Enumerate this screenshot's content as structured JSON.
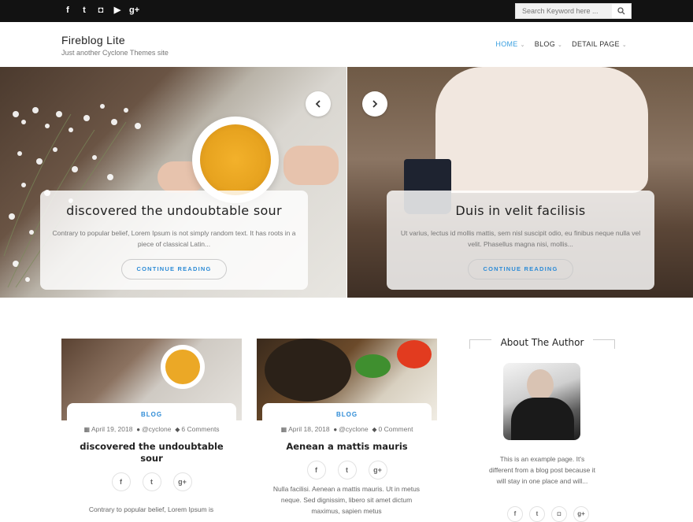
{
  "topbar": {
    "social": [
      {
        "icon": "facebook-icon",
        "glyph": "f"
      },
      {
        "icon": "twitter-icon",
        "glyph": "t"
      },
      {
        "icon": "instagram-icon",
        "glyph": "◘"
      },
      {
        "icon": "youtube-icon",
        "glyph": "▶"
      },
      {
        "icon": "googleplus-icon",
        "glyph": "g+"
      }
    ],
    "search_placeholder": "Search Keyword here ..."
  },
  "header": {
    "site_title": "Fireblog Lite",
    "tagline": "Just another Cyclone Themes site",
    "nav": [
      {
        "label": "HOME"
      },
      {
        "label": "BLOG"
      },
      {
        "label": "DETAIL PAGE"
      }
    ]
  },
  "slider": {
    "slides": [
      {
        "title": "discovered the undoubtable sour",
        "excerpt": "Contrary to popular belief, Lorem Ipsum is not simply random text. It has roots in a piece of classical Latin...",
        "button": "CONTINUE READING"
      },
      {
        "title": "Duis in velit facilisis",
        "excerpt": "Ut varius, lectus id mollis mattis, sem nisl suscipit odio, eu finibus neque nulla vel velit. Phasellus magna nisi, mollis...",
        "button": "CONTINUE READING"
      }
    ]
  },
  "posts": [
    {
      "category": "BLOG",
      "date": "April 19, 2018",
      "author": "@cyclone",
      "comments": "6 Comments",
      "title": "discovered the undoubtable sour",
      "excerpt": "Contrary to popular belief, Lorem Ipsum is"
    },
    {
      "category": "BLOG",
      "date": "April 18, 2018",
      "author": "@cyclone",
      "comments": "0 Comment",
      "title": "Aenean a mattis mauris",
      "excerpt": "Nulla facilisi. Aenean a mattis mauris. Ut in metus neque. Sed dignissim, libero sit amet dictum maximus, sapien metus"
    }
  ],
  "sidebar": {
    "widget_title": "About The Author",
    "author_text": "This is an example page. It's different from a blog post because it will stay in one place and will..."
  },
  "colors": {
    "accent": "#2d8bd6",
    "topbar": "#121212"
  }
}
